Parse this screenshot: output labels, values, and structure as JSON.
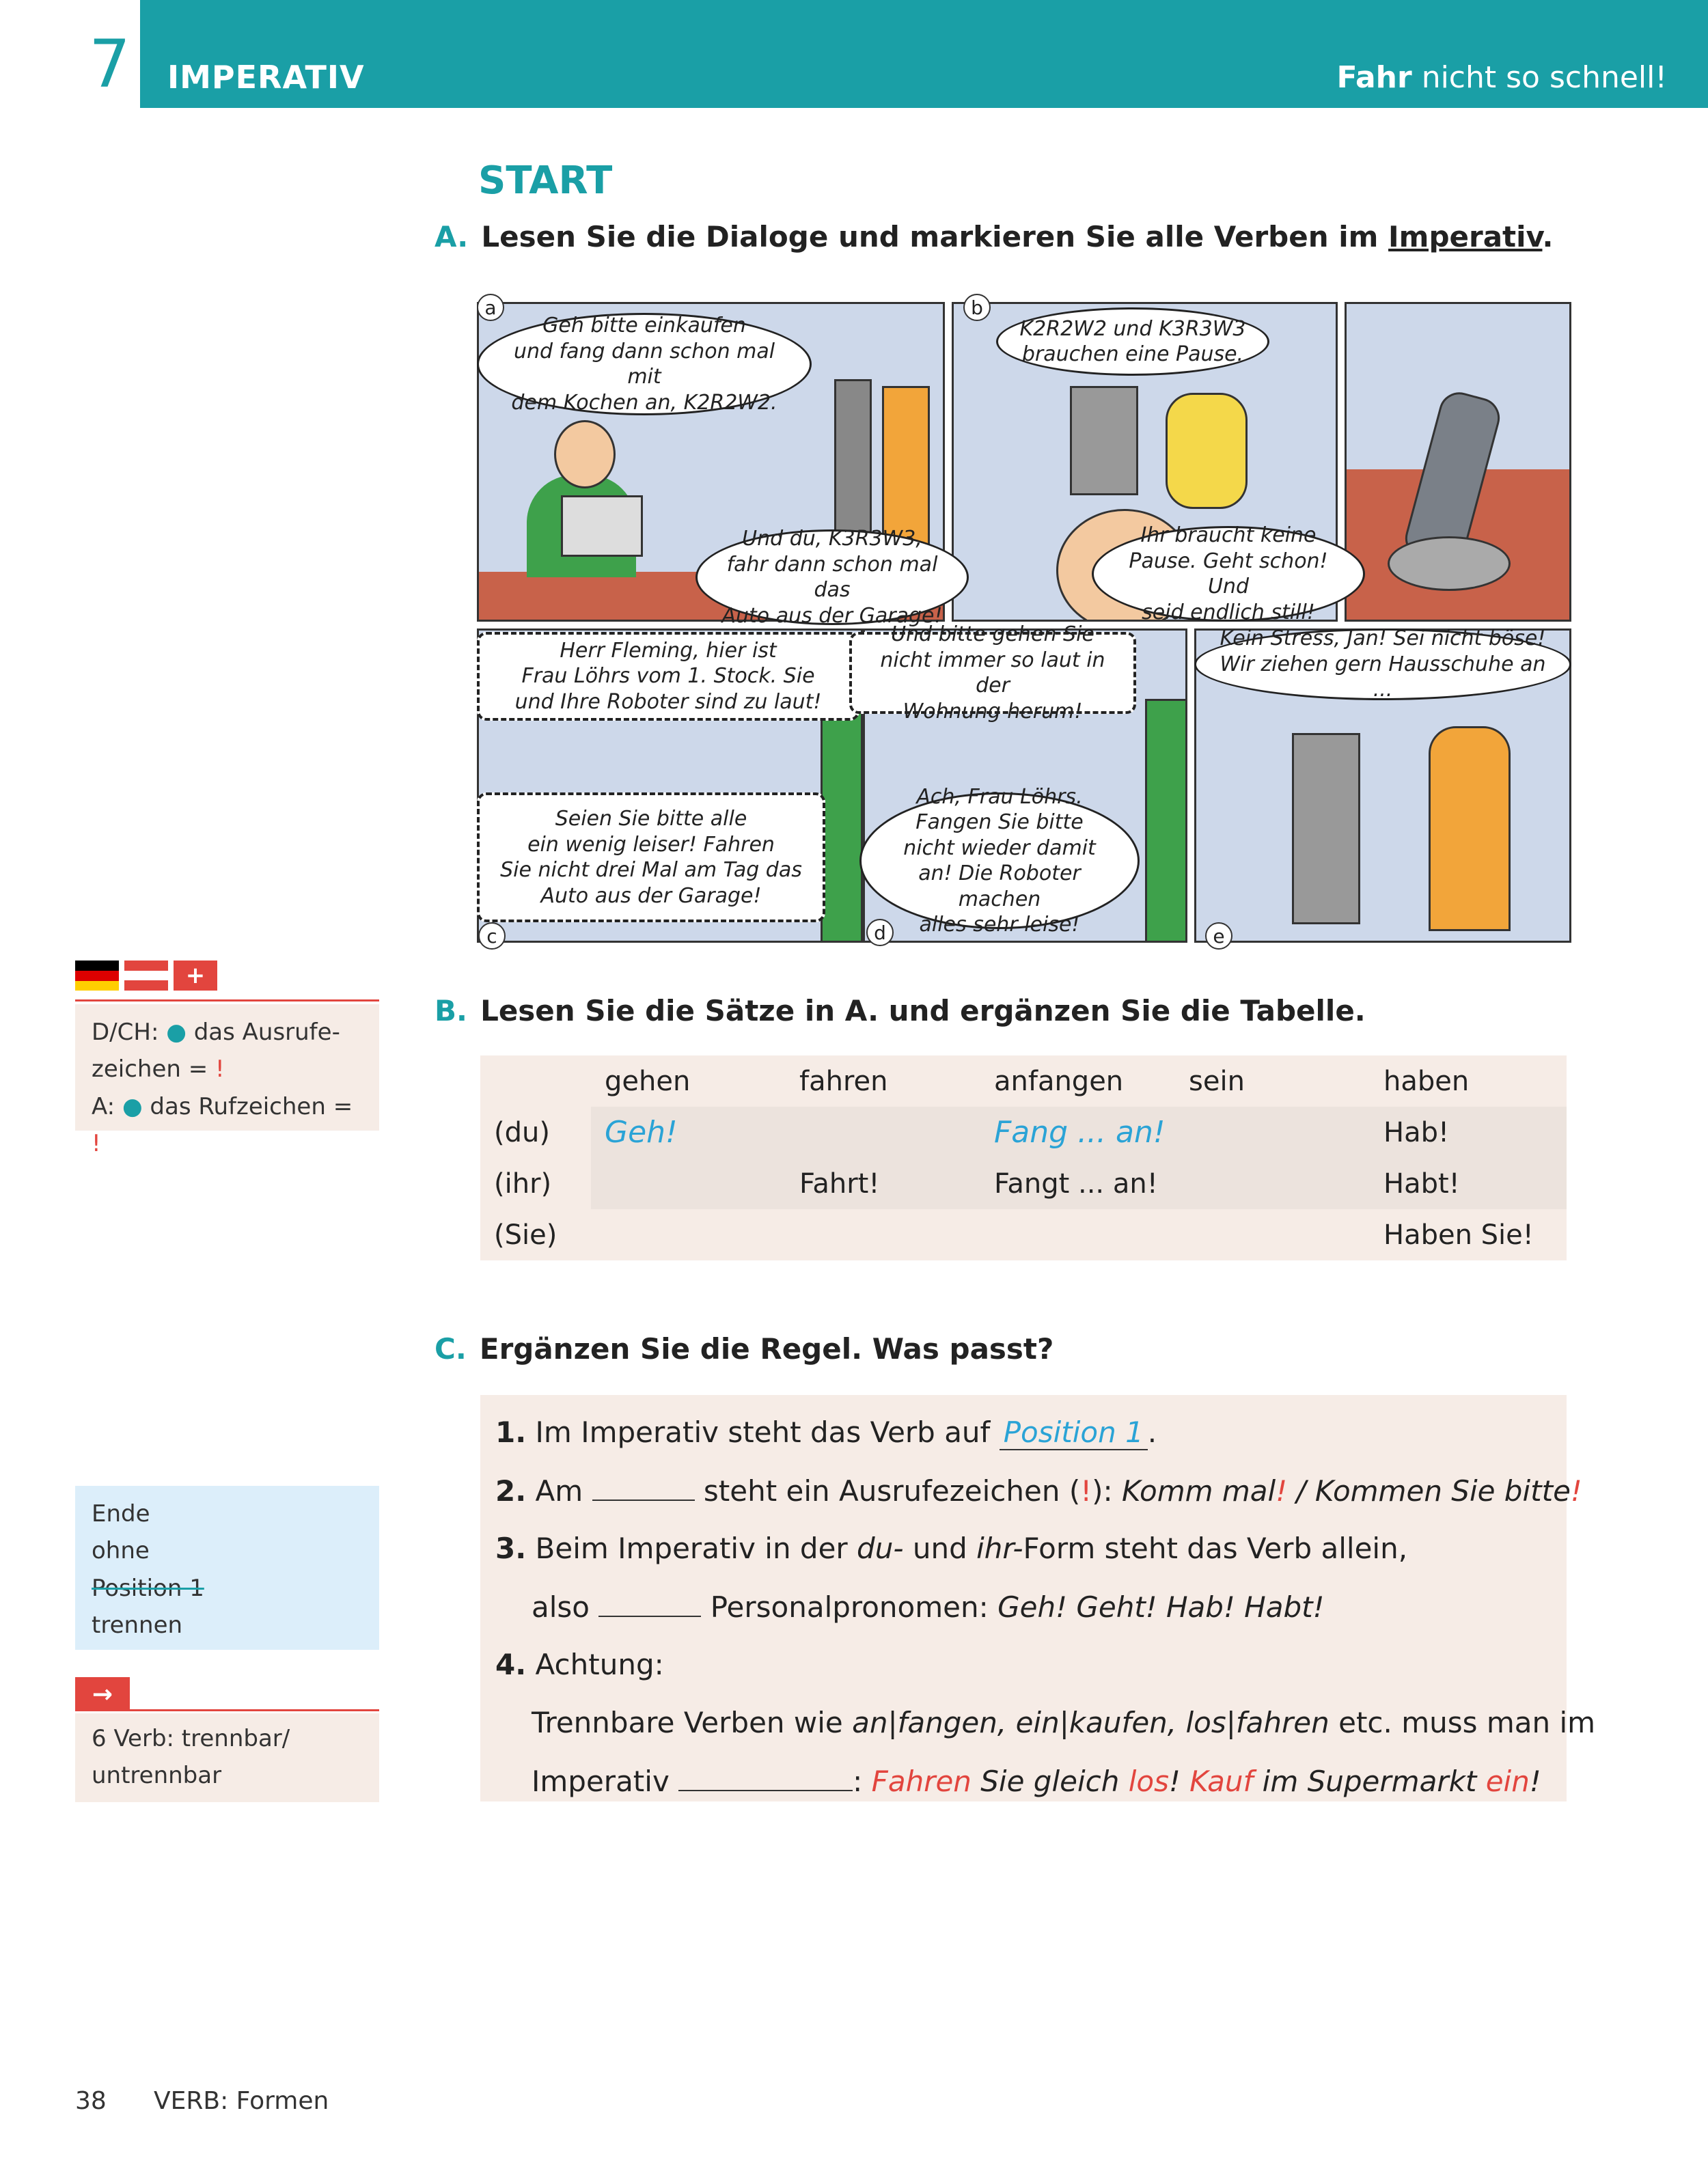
{
  "header": {
    "chapter_number": "7",
    "chapter_title": "IMPERATIV",
    "subtitle_bold": "Fahr",
    "subtitle_rest": " nicht so schnell!"
  },
  "start_heading": "START",
  "section_a": {
    "letter": "A.",
    "instruction_start": "Lesen Sie die Dialoge und markieren Sie alle Verben im ",
    "instruction_underlined": "Imperativ",
    "instruction_end": "."
  },
  "comic": {
    "panel_labels": [
      "a",
      "b",
      "c",
      "d",
      "e"
    ],
    "bubbles": {
      "a1": "Geh bitte einkaufen\nund fang dann schon mal mit\ndem Kochen an, K2R2W2.",
      "a2": "Und du, K3R3W3,\nfahr dann schon mal das\nAuto aus der Garage!",
      "b1": "K2R2W2 und K3R3W3\nbrauchen eine Pause.",
      "b2": "Ihr braucht keine\nPause. Geht schon! Und\nseid endlich still!",
      "c1": "Herr Fleming, hier ist\nFrau Löhrs vom 1. Stock. Sie\nund Ihre Roboter sind zu laut!",
      "c2": "Seien Sie bitte alle\nein wenig leiser! Fahren\nSie nicht drei Mal am Tag das\nAuto aus der Garage!",
      "d1": "Und bitte gehen Sie\nnicht immer so laut in der\nWohnung herum!",
      "d2": "Ach, Frau Löhrs.\nFangen Sie bitte\nnicht wieder damit\nan! Die Roboter machen\nalles sehr leise!",
      "e1": "Kein Stress, Jan! Sei nicht böse!\nWir ziehen gern Hausschuhe an ..."
    }
  },
  "sidebar": {
    "box1": {
      "line1_label": "D/CH: ",
      "line1_text": " das Ausrufe-",
      "line2_text": "zeichen = ",
      "line3_label": "A: ",
      "line3_text": " das Rufzeichen = ",
      "exclamation": "!"
    },
    "box2": {
      "words": [
        "Ende",
        "ohne",
        "Position 1",
        "trennen"
      ]
    },
    "arrow_box": {
      "arrow": "→",
      "line1": "6 Verb: trennbar/",
      "line2": "untrennbar"
    }
  },
  "section_b": {
    "letter": "B.",
    "instruction": "Lesen Sie die Sätze in A. und ergänzen Sie die Tabelle."
  },
  "table": {
    "headers": [
      "",
      "gehen",
      "fahren",
      "anfangen",
      "sein",
      "haben"
    ],
    "rows": [
      {
        "pronoun": "(du)",
        "cells": [
          "Geh!",
          "",
          "Fang ... an!",
          "",
          "Hab!"
        ]
      },
      {
        "pronoun": "(ihr)",
        "cells": [
          "",
          "Fahrt!",
          "Fangt ... an!",
          "",
          "Habt!"
        ]
      },
      {
        "pronoun": "(Sie)",
        "cells": [
          "",
          "",
          "",
          "",
          "Haben Sie!"
        ]
      }
    ]
  },
  "section_c": {
    "letter": "C.",
    "instruction": "Ergänzen Sie die Regel. Was passt?",
    "items": {
      "n1": "1.",
      "r1_text": "Im Imperativ steht das Verb auf ",
      "r1_answer": "Position 1",
      "r1_end": ".",
      "n2": "2.",
      "r2_start": "Am ",
      "r2_mid": " steht ein Ausrufezeichen (",
      "r2_excl": "!",
      "r2_after": "):  ",
      "r2_ex1": "Komm mal",
      "r2_ex_sep": " / ",
      "r2_ex2": "Kommen Sie bitte",
      "n3": "3.",
      "r3_a": "Beim Imperativ in der ",
      "r3_du": "du-",
      "r3_b": " und ",
      "r3_ihr": "ihr-",
      "r3_c": "Form steht das Verb allein,",
      "r3b_a": "also ",
      "r3b_b": " Personalpronomen: ",
      "r3b_ex": "Geh! Geht! Hab! Habt!",
      "n4": "4.",
      "r4_a": "Achtung:",
      "r4b_a": "Trennbare Verben wie ",
      "r4b_v1": "an|fangen, ein|kaufen, los|fahren",
      "r4b_b": " etc. muss man im",
      "r4c_a": "Imperativ ",
      "r4c_colon": ": ",
      "r4c_fahren": "Fahren",
      "r4c_sie": " Sie gleich ",
      "r4c_los": "los",
      "r4c_excl1": "! ",
      "r4c_kauf": "Kauf",
      "r4c_im": " im Supermarkt ",
      "r4c_ein": "ein",
      "r4c_excl2": "!"
    }
  },
  "footer": {
    "page_number": "38",
    "section": "VERB: Formen"
  },
  "colors": {
    "teal": "#1a9fa6",
    "red": "#e2453e",
    "answer_blue": "#2aa3d6",
    "sidebar_blue": "#dceefa",
    "table_shade": "#ece3dd"
  }
}
